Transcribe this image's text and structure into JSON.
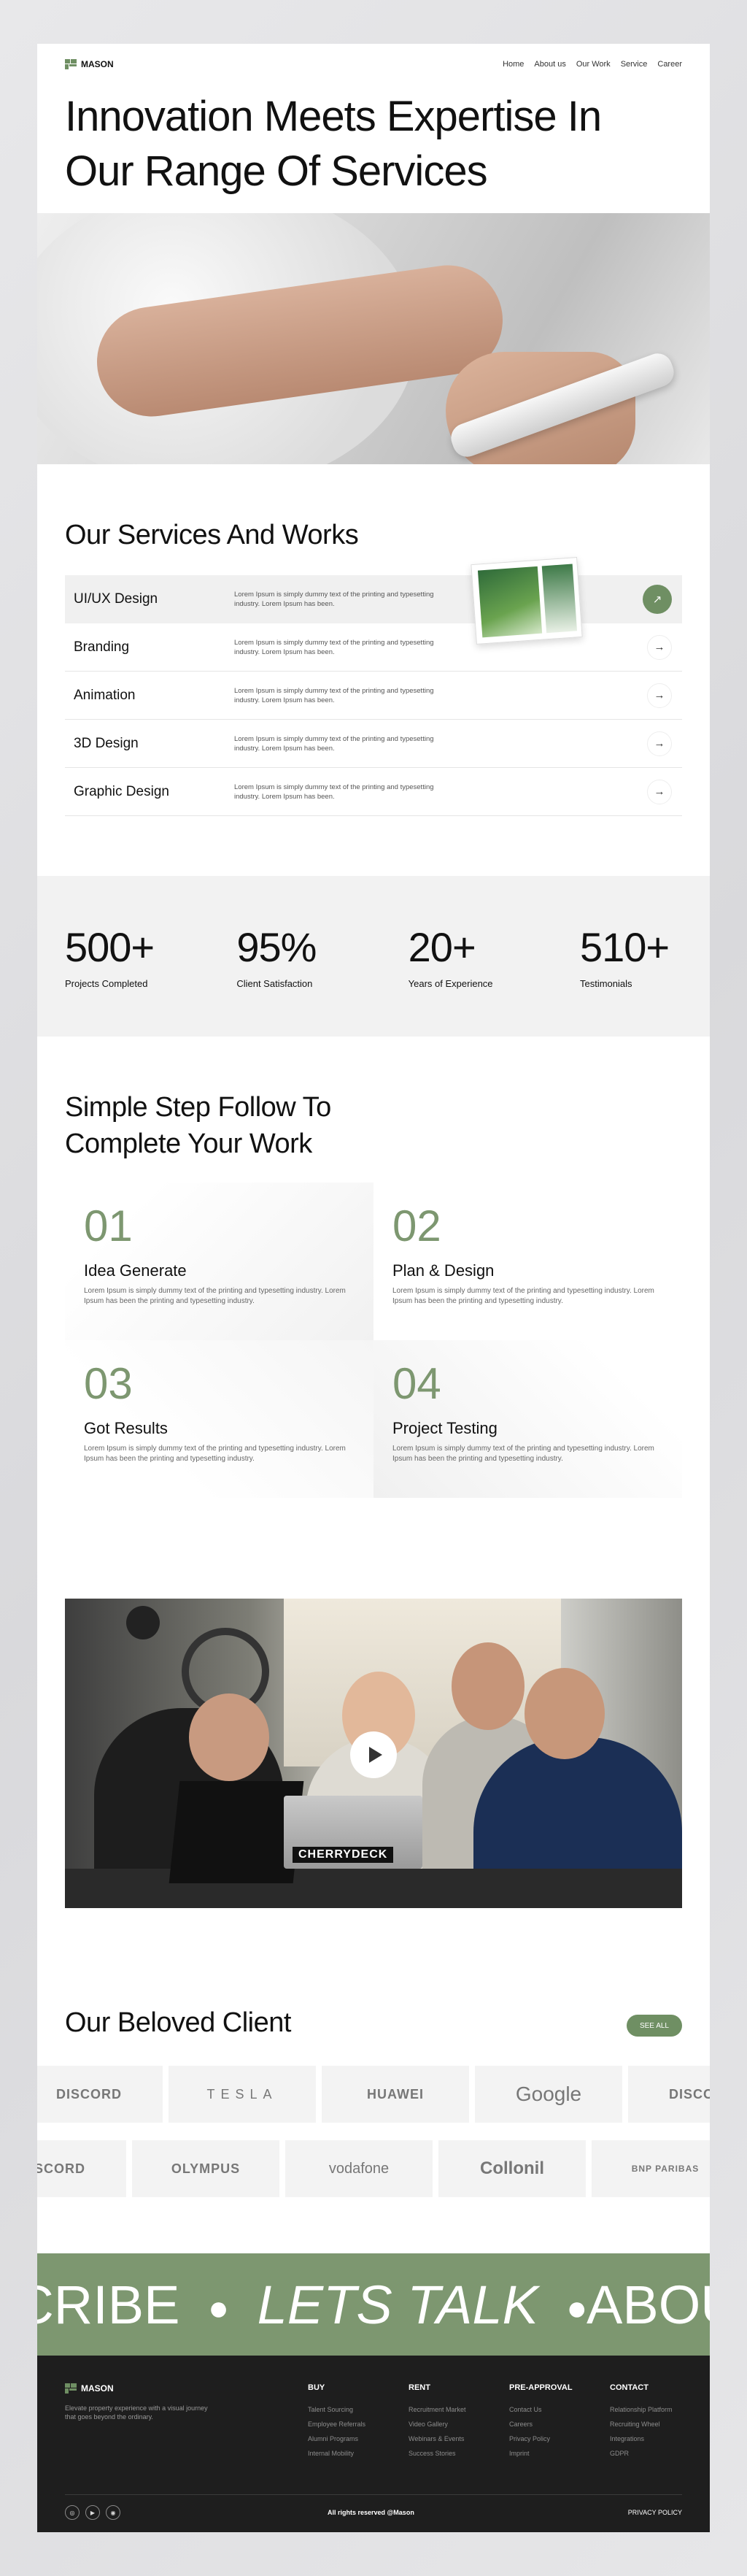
{
  "brand": {
    "name": "MASON",
    "accent": "#6f8f63"
  },
  "nav": {
    "links": [
      "Home",
      "About us",
      "Our Work",
      "Service",
      "Career"
    ]
  },
  "hero": {
    "title": "Innovation Meets Expertise In Our Range Of Services"
  },
  "services": {
    "title": "Our Services And Works",
    "items": [
      {
        "name": "UI/UX Design",
        "desc": "Lorem Ipsum is simply dummy text of the printing and typesetting industry. Lorem Ipsum has been."
      },
      {
        "name": "Branding",
        "desc": "Lorem Ipsum is simply dummy text of the printing and typesetting industry. Lorem Ipsum has been."
      },
      {
        "name": "Animation",
        "desc": "Lorem Ipsum is simply dummy text of the printing and typesetting industry. Lorem Ipsum has been."
      },
      {
        "name": "3D Design",
        "desc": "Lorem Ipsum is simply dummy text of the printing and typesetting industry. Lorem Ipsum has been."
      },
      {
        "name": "Graphic Design",
        "desc": "Lorem Ipsum is simply dummy text of the printing and typesetting industry. Lorem Ipsum has been."
      }
    ]
  },
  "stats": [
    {
      "value": "500+",
      "label": "Projects Completed"
    },
    {
      "value": "95%",
      "label": "Client Satisfaction"
    },
    {
      "value": "20+",
      "label": "Years of Experience"
    },
    {
      "value": "510+",
      "label": "Testimonials"
    }
  ],
  "steps": {
    "title": "Simple Step Follow To Complete Your Work",
    "items": [
      {
        "num": "01",
        "title": "Idea Generate",
        "desc": "Lorem Ipsum is simply dummy text of the printing and typesetting industry. Lorem Ipsum has been the printing and typesetting industry."
      },
      {
        "num": "02",
        "title": "Plan & Design",
        "desc": "Lorem Ipsum is simply dummy text of the printing and typesetting industry. Lorem Ipsum has been the printing and typesetting industry."
      },
      {
        "num": "03",
        "title": "Got Results",
        "desc": "Lorem Ipsum is simply dummy text of the printing and typesetting industry. Lorem Ipsum has been the printing and typesetting industry."
      },
      {
        "num": "04",
        "title": "Project Testing",
        "desc": "Lorem Ipsum is simply dummy text of the printing and typesetting industry. Lorem Ipsum has been the printing and typesetting industry."
      }
    ]
  },
  "video": {
    "laptop_sticker": "CHERRYDECK"
  },
  "clients": {
    "title": "Our Beloved Client",
    "see_all": "SEE ALL",
    "row1": [
      "DISCORD",
      "TESLA",
      "HUAWEI",
      "Google",
      "DISCORD"
    ],
    "row2": [
      "DISCORD",
      "OLYMPUS",
      "vodafone",
      "Collonil",
      "BNP PARIBAS"
    ]
  },
  "marquee": {
    "part1": "SCRIBE",
    "part2": "LETS TALK",
    "part3": "ABOU",
    "separator": "●"
  },
  "footer": {
    "tagline": "Elevate property experience with a visual journey that goes beyond the ordinary.",
    "columns": [
      {
        "title": "BUY",
        "links": [
          "Talent Sourcing",
          "Employee Referrals",
          "Alumni Programs",
          "Internal Mobility"
        ]
      },
      {
        "title": "RENT",
        "links": [
          "Recruitment Market",
          "Video Gallery",
          "Webinars & Events",
          "Success Stories"
        ]
      },
      {
        "title": "PRE-APPROVAL",
        "links": [
          "Contact Us",
          "Careers",
          "Privacy Policy",
          "Imprint"
        ]
      },
      {
        "title": "CONTACT",
        "links": [
          "Relationship Platform",
          "Recruiting Wheel",
          "Integrations",
          "GDPR"
        ]
      }
    ],
    "rights": "All rights reserved @Mason",
    "privacy": "PRIVACY POLICY",
    "social": [
      "instagram-icon",
      "youtube-icon",
      "camera-icon"
    ]
  }
}
